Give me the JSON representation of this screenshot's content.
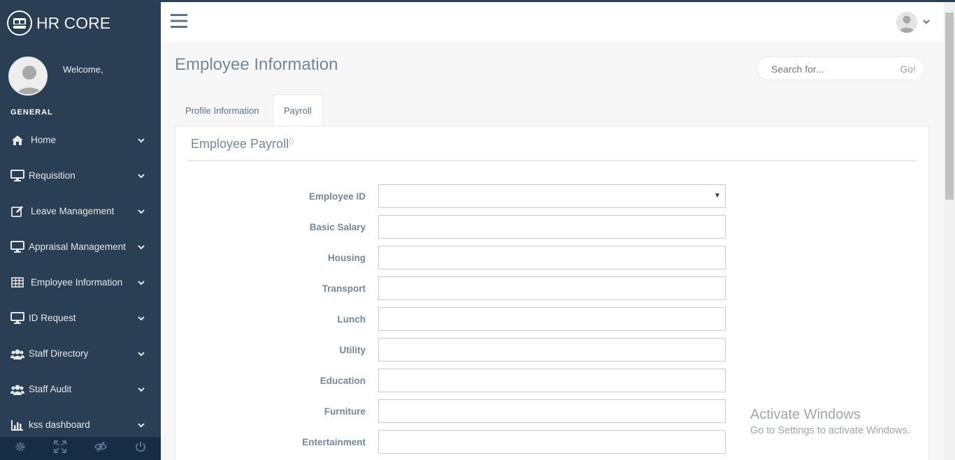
{
  "brand": {
    "title": "HR CORE"
  },
  "profile": {
    "welcome": "Welcome,"
  },
  "sidebar": {
    "section": "GENERAL",
    "items": [
      {
        "label": "Home",
        "icon": "home-icon"
      },
      {
        "label": "Requisition",
        "icon": "desktop-icon"
      },
      {
        "label": "Leave Management",
        "icon": "edit-icon"
      },
      {
        "label": "Appraisal Management",
        "icon": "desktop-icon"
      },
      {
        "label": "Employee Information",
        "icon": "table-icon"
      },
      {
        "label": "ID Request",
        "icon": "desktop-icon"
      },
      {
        "label": "Staff Directory",
        "icon": "users-icon"
      },
      {
        "label": "Staff Audit",
        "icon": "users-icon"
      },
      {
        "label": "kss dashboard",
        "icon": "bar-chart-icon"
      }
    ],
    "footer": [
      "gear-icon",
      "fullscreen-icon",
      "eye-slash-icon",
      "power-icon"
    ]
  },
  "page": {
    "title": "Employee Information"
  },
  "search": {
    "placeholder": "Search for...",
    "go": "Go!"
  },
  "tabs": [
    {
      "label": "Profile Information",
      "active": false
    },
    {
      "label": "Payroll",
      "active": true
    }
  ],
  "panel": {
    "title": "Employee Payroll",
    "title_suffix": "()",
    "fields": [
      {
        "label": "Employee ID",
        "type": "select",
        "value": ""
      },
      {
        "label": "Basic Salary",
        "type": "text",
        "value": ""
      },
      {
        "label": "Housing",
        "type": "text",
        "value": ""
      },
      {
        "label": "Transport",
        "type": "text",
        "value": ""
      },
      {
        "label": "Lunch",
        "type": "text",
        "value": ""
      },
      {
        "label": "Utility",
        "type": "text",
        "value": ""
      },
      {
        "label": "Education",
        "type": "text",
        "value": ""
      },
      {
        "label": "Furniture",
        "type": "text",
        "value": ""
      },
      {
        "label": "Entertainment",
        "type": "text",
        "value": ""
      }
    ]
  },
  "watermark": {
    "line1": "Activate Windows",
    "line2": "Go to Settings to activate Windows."
  },
  "colors": {
    "sidebar": "#2A3F54",
    "sidebar_footer": "#172D44",
    "text": "#73879C"
  }
}
